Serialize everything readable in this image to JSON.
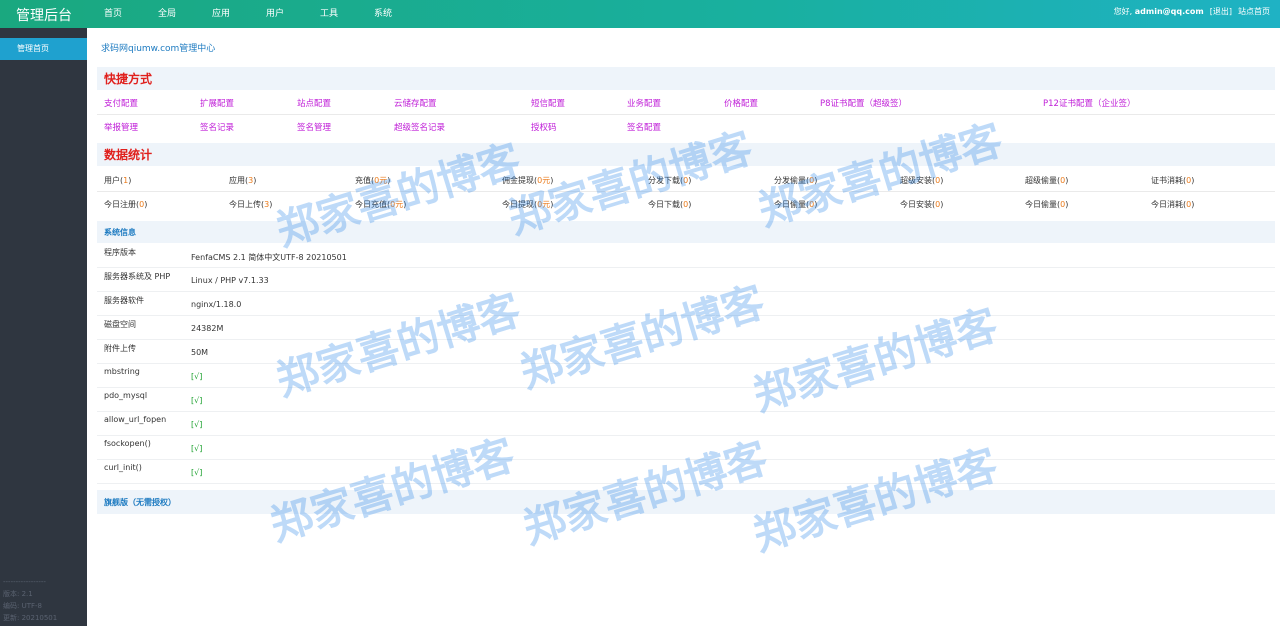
{
  "header": {
    "brand": "管理后台",
    "nav": [
      "首页",
      "全局",
      "应用",
      "用户",
      "工具",
      "系统"
    ],
    "greeting": "您好,",
    "user": "admin@qq.com",
    "logout": "[退出]",
    "site_home": "站点首页"
  },
  "sidebar": {
    "active_item": "管理首页",
    "footer": [
      "-----------------",
      "版本: 2.1",
      "编码: UTF-8",
      "更新: 20210501"
    ]
  },
  "breadcrumb": "求码网qiumw.com管理中心",
  "shortcuts": {
    "title": "快捷方式",
    "row1": [
      "支付配置",
      "扩展配置",
      "站点配置",
      "云储存配置",
      "短信配置",
      "业务配置",
      "价格配置",
      "P8证书配置（超级签）",
      "P12证书配置（企业签）"
    ],
    "row2": [
      "举报管理",
      "签名记录",
      "签名管理",
      "超级签名记录",
      "授权码",
      "签名配置"
    ]
  },
  "stats": {
    "title": "数据统计",
    "row1": [
      {
        "label": "用户",
        "value": "1"
      },
      {
        "label": "应用",
        "value": "3"
      },
      {
        "label": "充值",
        "value": "0元"
      },
      {
        "label": "佣金提现",
        "value": "0元"
      },
      {
        "label": "分发下载",
        "value": "0"
      },
      {
        "label": "分发偷量",
        "value": "0"
      },
      {
        "label": "超级安装",
        "value": "0"
      },
      {
        "label": "超级偷量",
        "value": "0"
      },
      {
        "label": "证书消耗",
        "value": "0"
      }
    ],
    "row2": [
      {
        "label": "今日注册",
        "value": "0"
      },
      {
        "label": "今日上传",
        "value": "3"
      },
      {
        "label": "今日充值",
        "value": "0元"
      },
      {
        "label": "今日提现",
        "value": "0元"
      },
      {
        "label": "今日下载",
        "value": "0"
      },
      {
        "label": "今日偷量",
        "value": "0"
      },
      {
        "label": "今日安装",
        "value": "0"
      },
      {
        "label": "今日偷量",
        "value": "0"
      },
      {
        "label": "今日消耗",
        "value": "0"
      }
    ]
  },
  "system": {
    "title": "系统信息",
    "rows": [
      {
        "key": "程序版本",
        "value": "FenfaCMS 2.1 简体中文UTF-8 20210501"
      },
      {
        "key": "服务器系统及 PHP",
        "value": "Linux / PHP v7.1.33"
      },
      {
        "key": "服务器软件",
        "value": "nginx/1.18.0"
      },
      {
        "key": "磁盘空间",
        "value": "24382M"
      },
      {
        "key": "附件上传",
        "value": "50M"
      },
      {
        "key": "mbstring",
        "value": "[√]"
      },
      {
        "key": "pdo_mysql",
        "value": "[√]"
      },
      {
        "key": "allow_url_fopen",
        "value": "[√]"
      },
      {
        "key": "fsockopen()",
        "value": "[√]"
      },
      {
        "key": "curl_init()",
        "value": "[√]"
      }
    ]
  },
  "edition": "旗舰版（无需授权）",
  "watermark": "郑家喜的博客",
  "colors": {
    "accent": "#1fa1cf",
    "link": "#c020d8",
    "title_red": "#e0201d",
    "ok_green": "#1aa02c",
    "number": "#ea7a1a"
  }
}
